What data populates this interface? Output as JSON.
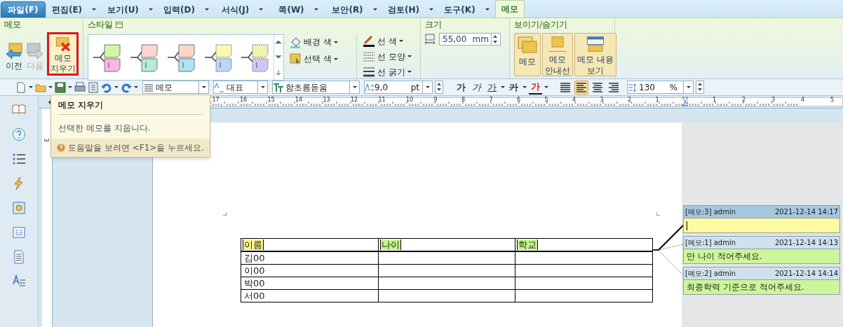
{
  "tabs": [
    {
      "label": "파일(F)",
      "kind": "file",
      "selected": false
    },
    {
      "label": "편집(E)",
      "kind": "menu",
      "selected": false
    },
    {
      "label": "보기(U)",
      "kind": "menu",
      "selected": false
    },
    {
      "label": "입력(D)",
      "kind": "menu",
      "selected": false
    },
    {
      "label": "서식(J)",
      "kind": "menu",
      "selected": false
    },
    {
      "label": "쪽(W)",
      "kind": "menu",
      "selected": false
    },
    {
      "label": "보안(R)",
      "kind": "menu",
      "selected": false
    },
    {
      "label": "검토(H)",
      "kind": "menu",
      "selected": false
    },
    {
      "label": "도구(K)",
      "kind": "menu",
      "selected": false
    },
    {
      "label": "메모",
      "kind": "context",
      "selected": true
    }
  ],
  "memo_group": {
    "title": "메모",
    "buttons": [
      {
        "label": "이전",
        "kind": "prev",
        "disabled": false,
        "highlighted": false
      },
      {
        "label": "다음",
        "kind": "next",
        "disabled": true,
        "highlighted": false
      },
      {
        "label": "메모\n지우기",
        "kind": "delete",
        "disabled": false,
        "highlighted": true
      }
    ]
  },
  "style_group": {
    "title": "스타일",
    "gallery": [
      {
        "title_part": {
          "color": "#d4f5a6"
        },
        "body_part": {
          "color": "#f9b6e0"
        },
        "dashed": false
      },
      {
        "title_part": {
          "color": "#fcd6d2"
        },
        "body_part": {
          "color": "#b6ecd2"
        },
        "dashed": false
      },
      {
        "title_part": {
          "color": "#fcd6c6"
        },
        "body_part": {
          "color": "#b0e2f4"
        },
        "dashed": false
      },
      {
        "title_part": {
          "color": "#fbf8b6"
        },
        "body_part": {
          "color": "#bcd6f8"
        },
        "dashed": true
      },
      {
        "title_part": {
          "color": "#eef4b0"
        },
        "body_part": {
          "color": "#d2c6f6"
        },
        "dashed": true
      }
    ],
    "color_buttons": [
      {
        "label": "배경 색",
        "kind": "fill"
      },
      {
        "label": "선택 색",
        "kind": "select"
      }
    ],
    "line_buttons": [
      {
        "label": "선 색",
        "kind": "color"
      },
      {
        "label": "선 모양",
        "kind": "style"
      },
      {
        "label": "선 굵기",
        "kind": "weight"
      }
    ]
  },
  "size_group": {
    "title": "크기",
    "value": "55,00",
    "unit": "mm"
  },
  "show_group": {
    "title": "보이기/숨기기",
    "buttons": [
      {
        "label": "메모",
        "kind": "memo",
        "on": true
      },
      {
        "label": "메모\n안내선",
        "kind": "guide",
        "on": true
      },
      {
        "label": "메모 내용\n보기",
        "kind": "content",
        "on": true
      }
    ]
  },
  "toolbar": {
    "style": "메모",
    "language": "대표",
    "font": "함초롬돋움",
    "size": "9,0",
    "size_unit": "pt",
    "format_buttons": [
      {
        "label": "가",
        "kind": "bold"
      },
      {
        "label": "가",
        "kind": "italic"
      },
      {
        "label": "가",
        "kind": "underline"
      },
      {
        "label": "가",
        "kind": "strike"
      },
      {
        "label": "가",
        "kind": "color"
      }
    ],
    "align_buttons": [
      {
        "kind": "justify",
        "selected": false
      },
      {
        "kind": "left",
        "selected": true
      },
      {
        "kind": "center",
        "selected": false
      },
      {
        "kind": "right",
        "selected": false
      }
    ],
    "line_spacing": "130",
    "line_spacing_unit": "%"
  },
  "tooltip": {
    "title": "메모 지우기",
    "description": "선택한 메모를 지웁니다.",
    "help": "도움말을 보려면 <F1>을 누르세요."
  },
  "ruler": {
    "left_numbers": [
      "17",
      "16",
      "15",
      "14",
      "13",
      "12",
      "11",
      "10",
      "9",
      "8",
      "7",
      "6",
      "5",
      "4",
      "3",
      "2",
      "1"
    ],
    "right_numbers": [
      "1",
      "2",
      "3",
      "4",
      "5"
    ],
    "vertical_numbers": [
      "3"
    ]
  },
  "table": {
    "header": [
      {
        "text": "이름",
        "color": "#fbf48a"
      },
      {
        "text": "나이",
        "color": "#c6f58c"
      },
      {
        "text": "학교",
        "color": "#c6f58c"
      }
    ],
    "rows": [
      [
        "김00",
        "",
        ""
      ],
      [
        "이00",
        "",
        ""
      ],
      [
        "박00",
        "",
        ""
      ],
      [
        "서00",
        "",
        ""
      ]
    ]
  },
  "memos": [
    {
      "label": "[메모:3] admin",
      "time": "2021-12-14 14:17",
      "color": "#fdfaa0",
      "selected": true
    },
    {
      "label": "[메모:1] admin",
      "time": "2021-12-14 14:13",
      "body": "만 나이 적어주세요.",
      "color": "#cdf59a",
      "selected": false
    },
    {
      "label": "[메모:2] admin",
      "time": "2021-12-14 14:14",
      "body": "최종학력 기준으로 적어주세요.",
      "color": "#cdf59a",
      "selected": false
    }
  ]
}
